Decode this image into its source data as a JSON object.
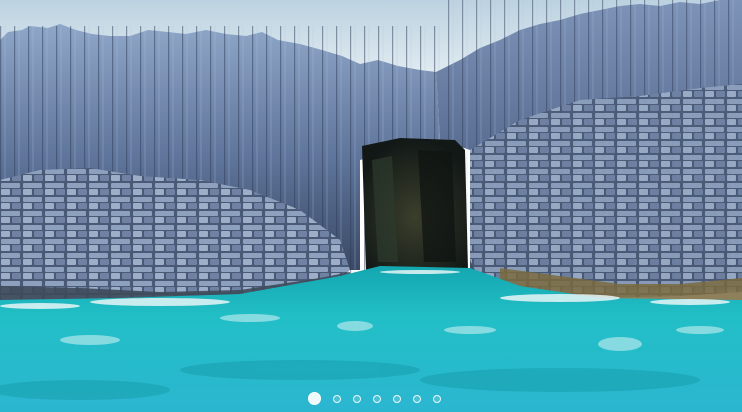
{
  "carousel": {
    "active_index": 0,
    "slide_count": 7,
    "slides": [
      {
        "subject": "basalt-columns-sea-cave"
      }
    ]
  },
  "colors": {
    "sky": "#c9dbe6",
    "rock_light": "#7f95b8",
    "rock_dark": "#2c3a55",
    "cave": "#1d2620",
    "sea": "#1fb8c4",
    "foam": "#e8f6f7"
  }
}
